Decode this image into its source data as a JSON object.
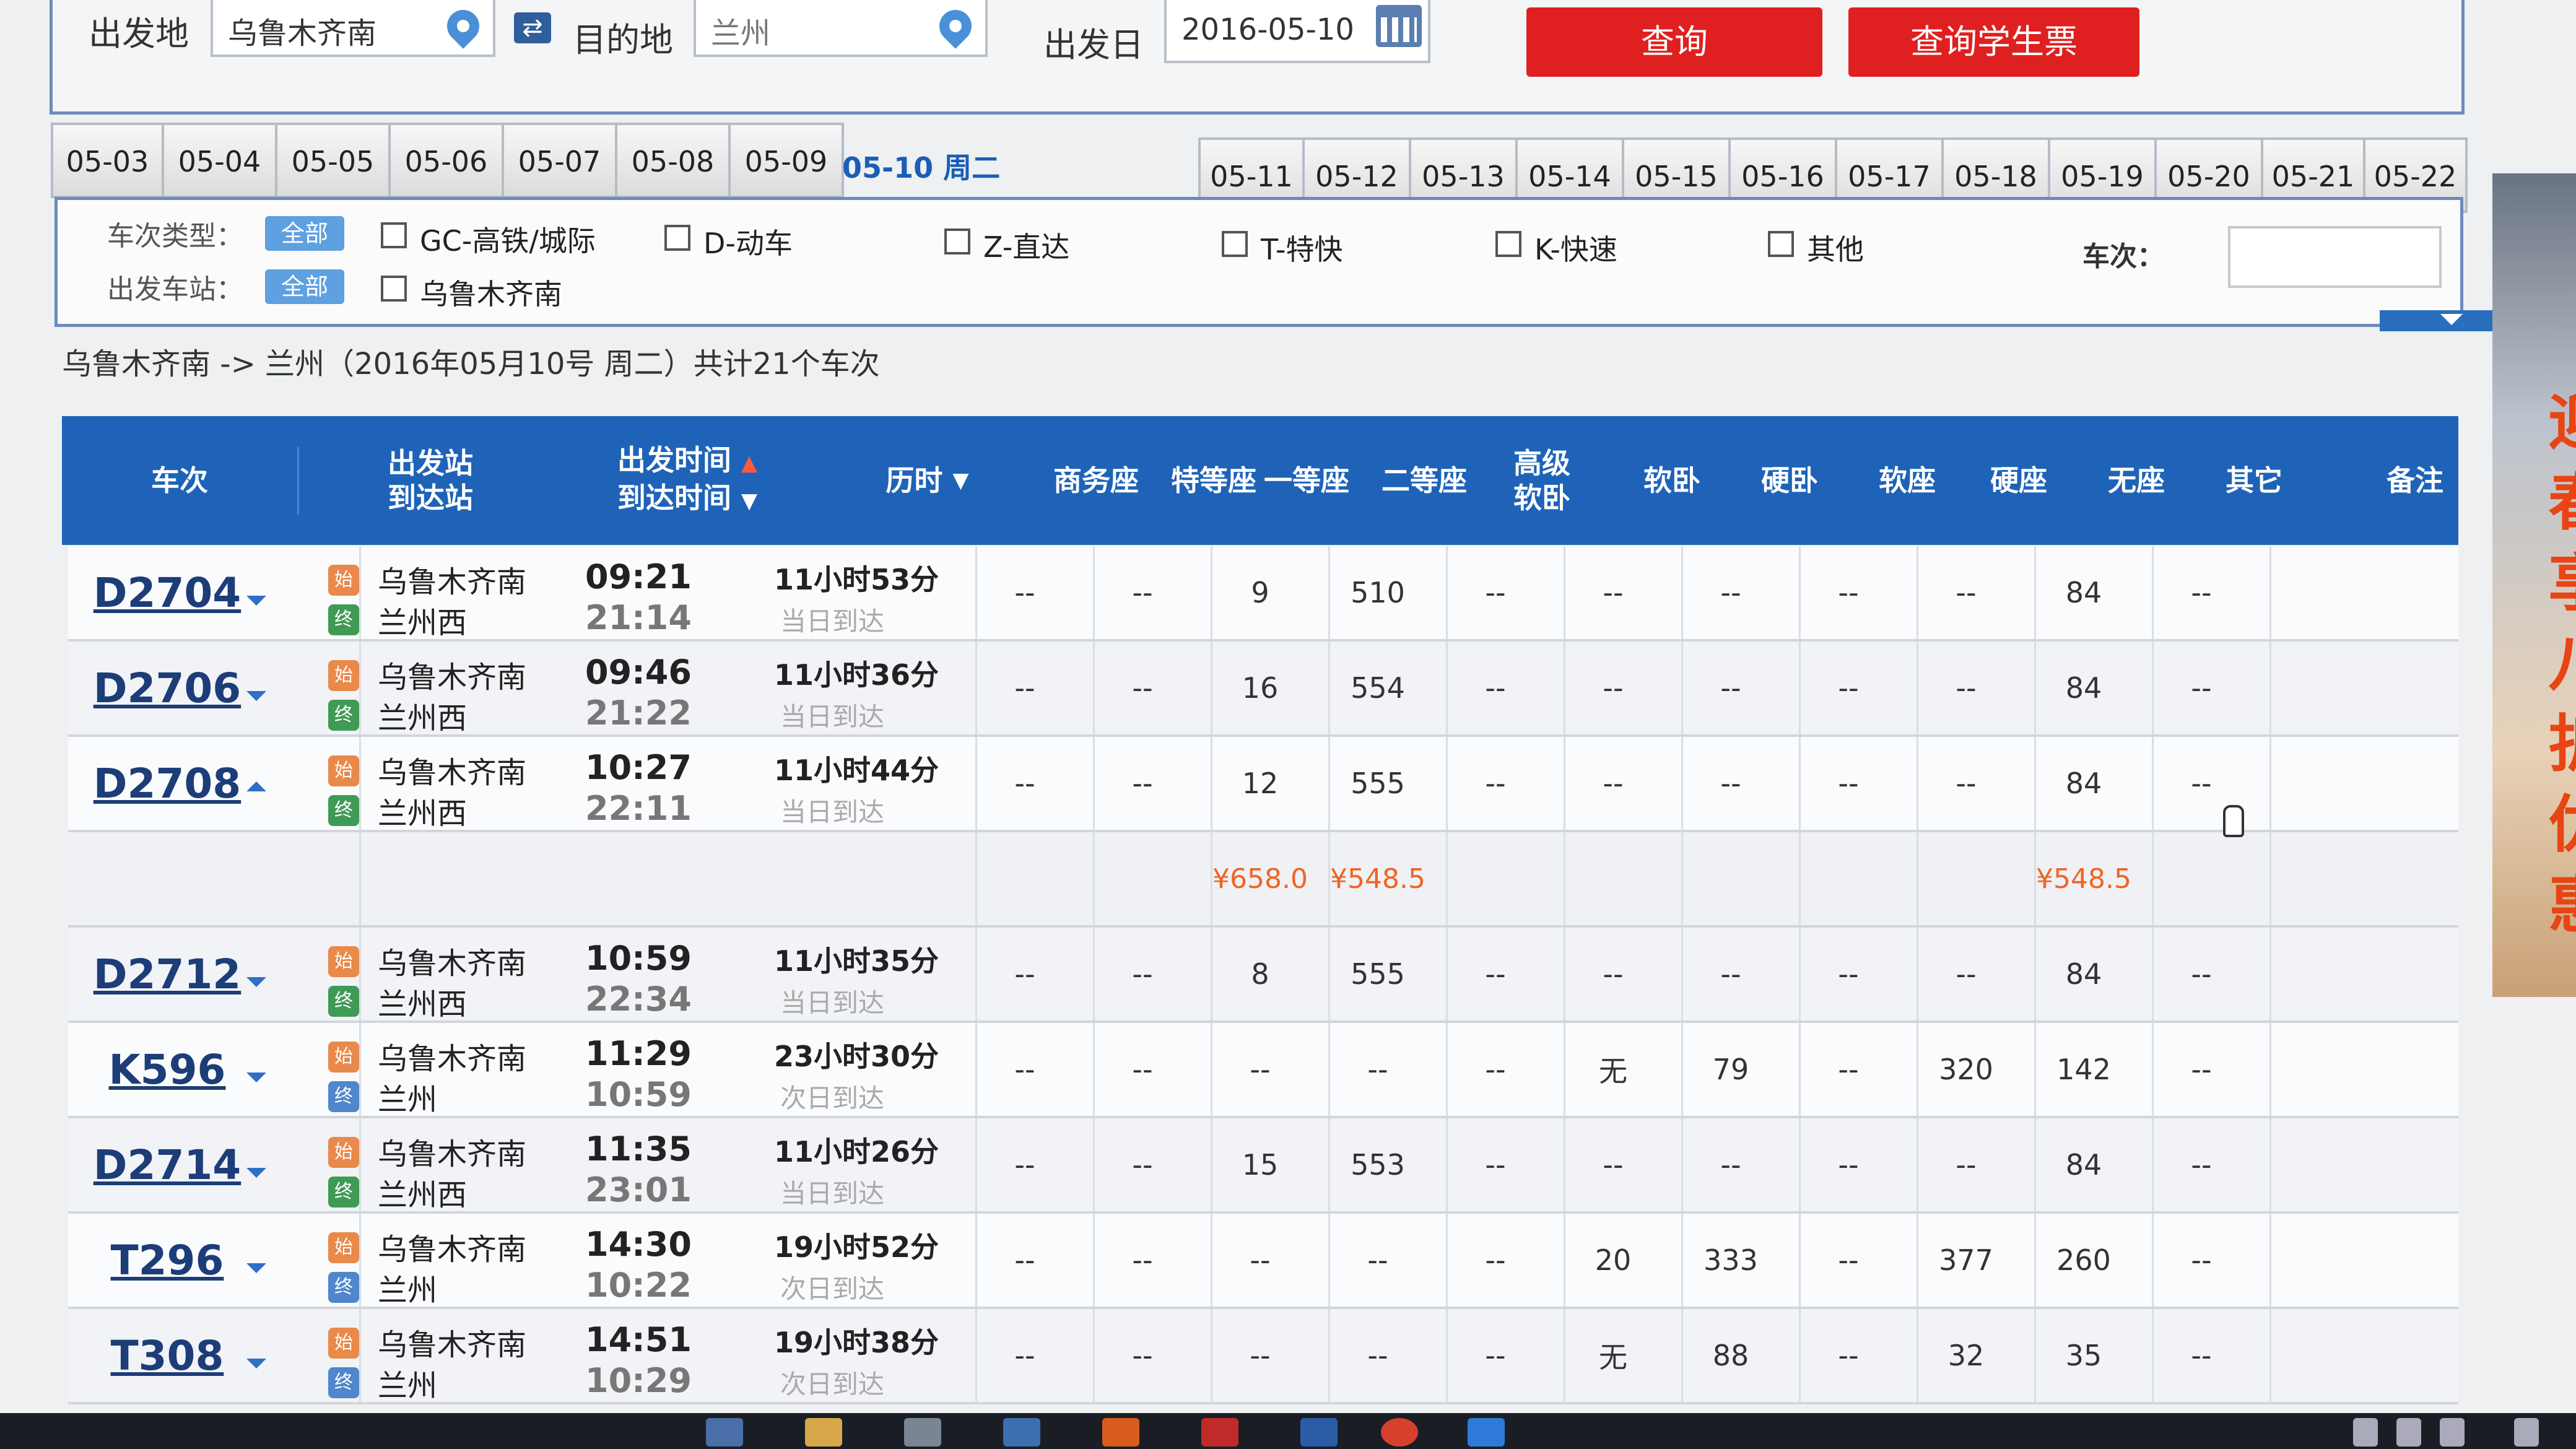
{
  "search": {
    "from_label": "出发地",
    "from_value": "乌鲁木齐南",
    "to_label": "目的地",
    "to_value": "兰州",
    "date_label": "出发日",
    "date_value": "2016-05-10",
    "query_button": "查询",
    "student_button": "查询学生票"
  },
  "date_tabs_before": [
    "05-03",
    "05-04",
    "05-05",
    "05-06",
    "05-07",
    "05-08",
    "05-09"
  ],
  "date_current": "05-10 周二",
  "date_tabs_after": [
    "05-11",
    "05-12",
    "05-13",
    "05-14",
    "05-15",
    "05-16",
    "05-17",
    "05-18",
    "05-19",
    "05-20",
    "05-21",
    "05-22"
  ],
  "filters": {
    "type_label": "车次类型：",
    "all_label": "全部",
    "station_label": "出发车站：",
    "types": [
      "GC-高铁/城际",
      "D-动车",
      "Z-直达",
      "T-特快",
      "K-快速",
      "其他"
    ],
    "station_option": "乌鲁木齐南",
    "train_no_label": "车次："
  },
  "summary": "乌鲁木齐南 -> 兰州（2016年05月10号  周二）共计21个车次",
  "table_headers": {
    "train": "车次",
    "station1": "出发站",
    "station2": "到达站",
    "time1": "出发时间",
    "time2": "到达时间",
    "duration": "历时",
    "business": "商务座",
    "special": "特等座",
    "first": "一等座",
    "second": "二等座",
    "adv_soft1": "高级",
    "adv_soft2": "软卧",
    "soft_sleeper": "软卧",
    "hard_sleeper": "硬卧",
    "soft_seat": "软座",
    "hard_seat": "硬座",
    "no_seat": "无座",
    "other": "其它",
    "note": "备注"
  },
  "trains": [
    {
      "no": "D2704",
      "from": "乌鲁木齐南",
      "to": "兰州西",
      "dep": "09:21",
      "arr": "21:14",
      "dur": "11小时53分",
      "arrival_note": "当日到达",
      "seats": [
        "--",
        "--",
        "9",
        "510",
        "--",
        "--",
        "--",
        "--",
        "--",
        "84",
        "--",
        ""
      ]
    },
    {
      "no": "D2706",
      "from": "乌鲁木齐南",
      "to": "兰州西",
      "dep": "09:46",
      "arr": "21:22",
      "dur": "11小时36分",
      "arrival_note": "当日到达",
      "seats": [
        "--",
        "--",
        "16",
        "554",
        "--",
        "--",
        "--",
        "--",
        "--",
        "84",
        "--",
        ""
      ]
    },
    {
      "no": "D2708",
      "from": "乌鲁木齐南",
      "to": "兰州西",
      "dep": "10:27",
      "arr": "22:11",
      "dur": "11小时44分",
      "arrival_note": "当日到达",
      "seats": [
        "--",
        "--",
        "12",
        "555",
        "--",
        "--",
        "--",
        "--",
        "--",
        "84",
        "--",
        ""
      ],
      "expanded": true
    },
    {
      "no": "D2712",
      "from": "乌鲁木齐南",
      "to": "兰州西",
      "dep": "10:59",
      "arr": "22:34",
      "dur": "11小时35分",
      "arrival_note": "当日到达",
      "seats": [
        "--",
        "--",
        "8",
        "555",
        "--",
        "--",
        "--",
        "--",
        "--",
        "84",
        "--",
        ""
      ]
    },
    {
      "no": "K596",
      "from": "乌鲁木齐南",
      "to": "兰州",
      "dep": "11:29",
      "arr": "10:59",
      "dur": "23小时30分",
      "arrival_note": "次日到达",
      "seats": [
        "--",
        "--",
        "--",
        "--",
        "--",
        "无",
        "79",
        "--",
        "320",
        "142",
        "--",
        ""
      ]
    },
    {
      "no": "D2714",
      "from": "乌鲁木齐南",
      "to": "兰州西",
      "dep": "11:35",
      "arr": "23:01",
      "dur": "11小时26分",
      "arrival_note": "当日到达",
      "seats": [
        "--",
        "--",
        "15",
        "553",
        "--",
        "--",
        "--",
        "--",
        "--",
        "84",
        "--",
        ""
      ]
    },
    {
      "no": "T296",
      "from": "乌鲁木齐南",
      "to": "兰州",
      "dep": "14:30",
      "arr": "10:22",
      "dur": "19小时52分",
      "arrival_note": "次日到达",
      "seats": [
        "--",
        "--",
        "--",
        "--",
        "--",
        "20",
        "333",
        "--",
        "377",
        "260",
        "--",
        ""
      ]
    },
    {
      "no": "T308",
      "from": "乌鲁木齐南",
      "to": "兰州",
      "dep": "14:51",
      "arr": "10:29",
      "dur": "19小时38分",
      "arrival_note": "次日到达",
      "seats": [
        "--",
        "--",
        "--",
        "--",
        "--",
        "无",
        "88",
        "--",
        "32",
        "35",
        "--",
        ""
      ]
    }
  ],
  "price_row": {
    "first": "¥658.0",
    "second": "¥548.5",
    "no_seat": "¥548.5"
  },
  "side_ad_text": [
    "迎",
    "春",
    "享",
    "八",
    "折",
    "优",
    "惠"
  ],
  "colors": {
    "header_blue": "#1e63b8",
    "query_red": "#e02020",
    "price_orange": "#f06424",
    "link_navy": "#1c3d78"
  }
}
